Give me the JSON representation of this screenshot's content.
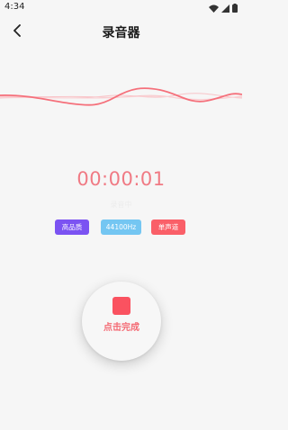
{
  "status_bar": {
    "time": "4:34",
    "icons": [
      "wifi-icon",
      "signal-icon",
      "battery-icon"
    ]
  },
  "header": {
    "title": "录音器",
    "back_icon": "chevron-left-icon"
  },
  "recorder": {
    "timer": "00:00:01",
    "status": "录音中",
    "tags": {
      "quality": "高品质",
      "sample_rate": "44100Hz",
      "channel": "单声道"
    },
    "action_label": "点击完成"
  },
  "colors": {
    "accent": "#fa5260",
    "quality_tag": "#7b53f2",
    "rate_tag": "#74c6f2",
    "channel_tag": "#fa5f68",
    "timer_text": "#f07a84"
  }
}
